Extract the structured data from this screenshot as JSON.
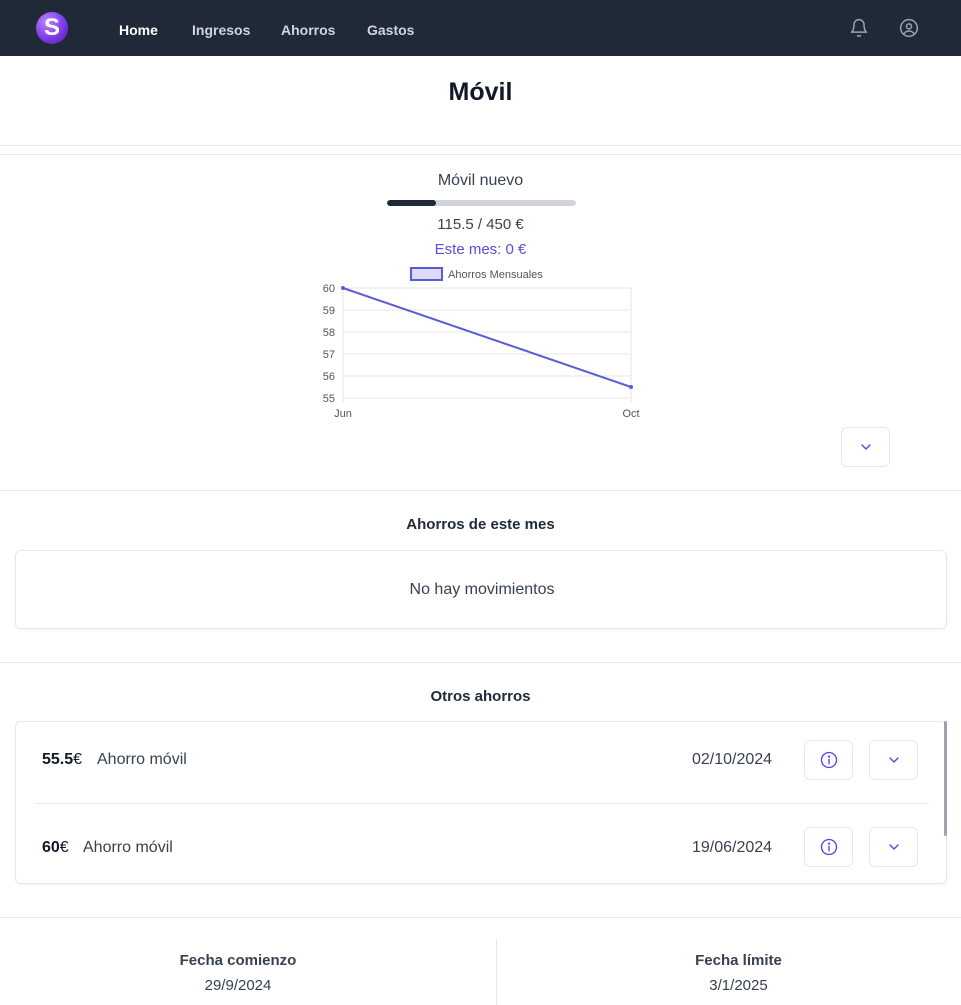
{
  "nav": {
    "logo_text": "S",
    "links": [
      "Home",
      "Ingresos",
      "Ahorros",
      "Gastos"
    ],
    "active": "Home",
    "icons": [
      "bell-icon",
      "user-circle-icon"
    ]
  },
  "page": {
    "title": "Móvil"
  },
  "goal": {
    "name": "Móvil nuevo",
    "amount_text": "115.5 / 450 €",
    "progress": 0.2567,
    "month_text": "Este mes: 0 €",
    "accent_color": "#5b4fd9"
  },
  "chart_data": {
    "type": "line",
    "categories": [
      "Jun",
      "Oct"
    ],
    "series": [
      {
        "name": "Ahorros Mensuales",
        "values": [
          60,
          55.5
        ]
      }
    ],
    "yticks": [
      55,
      56,
      57,
      58,
      59,
      60
    ],
    "ylim": [
      55,
      60
    ],
    "grid": true,
    "legend": "top",
    "color": "#5b5bd6"
  },
  "sections": {
    "this_month_title": "Ahorros de este mes",
    "empty_text": "No hay movimientos",
    "others_title": "Otros ahorros"
  },
  "savings": [
    {
      "amount": "55.5",
      "currency": "€",
      "description": "Ahorro móvil",
      "date": "02/10/2024"
    },
    {
      "amount": "60",
      "currency": "€",
      "description": "Ahorro móvil",
      "date": "19/06/2024"
    }
  ],
  "dates": {
    "start_label": "Fecha comienzo",
    "start_value": "29/9/2024",
    "end_label": "Fecha límite",
    "end_value": "3/1/2025"
  },
  "icons": {
    "expand": "chevron-down-icon",
    "info": "info-icon"
  }
}
